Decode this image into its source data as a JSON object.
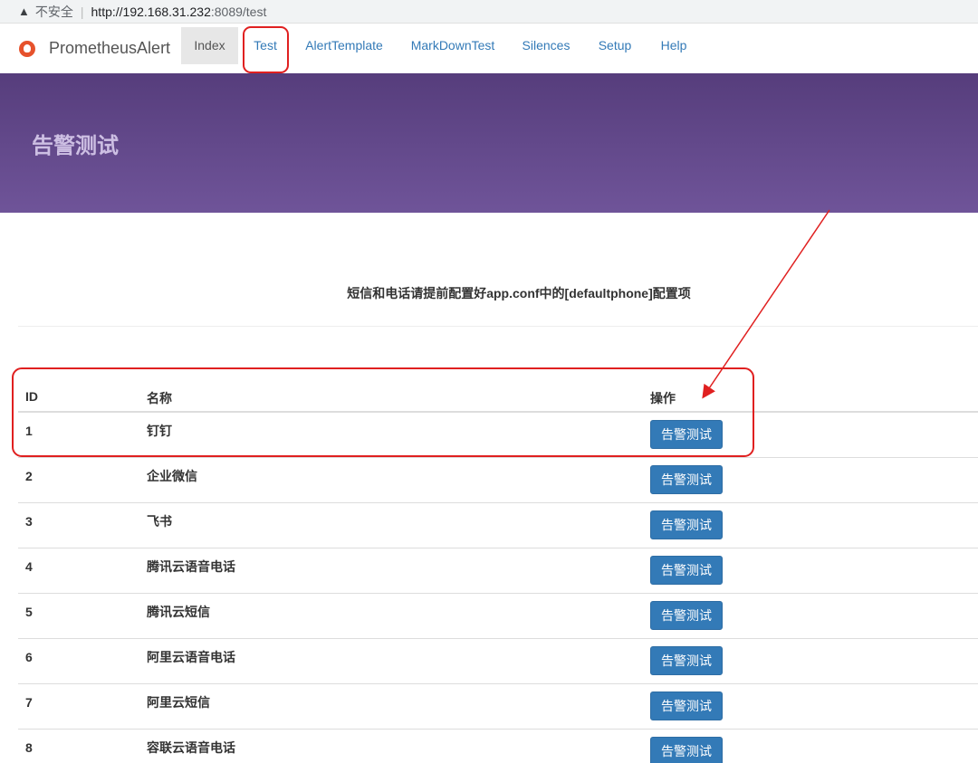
{
  "browser": {
    "security_label": "不安全",
    "url_host": "http://192.168.31.232",
    "url_rest": ":8089/test"
  },
  "navbar": {
    "brand": "PrometheusAlert",
    "items": [
      {
        "label": "Index"
      },
      {
        "label": "Test"
      },
      {
        "label": "AlertTemplate"
      },
      {
        "label": "MarkDownTest"
      },
      {
        "label": "Silences"
      },
      {
        "label": "Setup"
      },
      {
        "label": "Help"
      }
    ]
  },
  "hero": {
    "title": "告警测试"
  },
  "notice": "短信和电话请提前配置好app.conf中的[defaultphone]配置项",
  "table": {
    "headers": {
      "id": "ID",
      "name": "名称",
      "action": "操作"
    },
    "rows": [
      {
        "id": "1",
        "name": "钉钉",
        "action": "告警测试"
      },
      {
        "id": "2",
        "name": "企业微信",
        "action": "告警测试"
      },
      {
        "id": "3",
        "name": "飞书",
        "action": "告警测试"
      },
      {
        "id": "4",
        "name": "腾讯云语音电话",
        "action": "告警测试"
      },
      {
        "id": "5",
        "name": "腾讯云短信",
        "action": "告警测试"
      },
      {
        "id": "6",
        "name": "阿里云语音电话",
        "action": "告警测试"
      },
      {
        "id": "7",
        "name": "阿里云短信",
        "action": "告警测试"
      },
      {
        "id": "8",
        "name": "容联云语音电话",
        "action": "告警测试"
      }
    ]
  },
  "colors": {
    "hero_gradient_top": "#563d7c",
    "hero_gradient_bottom": "#6f5499",
    "button": "#337ab7",
    "annotation": "#e02020"
  }
}
